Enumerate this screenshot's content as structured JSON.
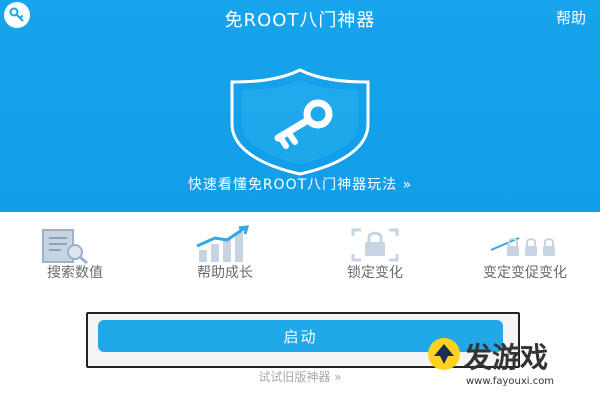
{
  "header": {
    "title": "免ROOT八门神器",
    "help_label": "帮助",
    "app_icon": "key-logo-icon"
  },
  "hero": {
    "shield_icon": "shield-key-icon",
    "tagline": "快速看懂免ROOT八门神器玩法 »"
  },
  "features": [
    {
      "label": "搜索数值",
      "icon": "search-document-icon"
    },
    {
      "label": "帮助成长",
      "icon": "growth-chart-icon"
    },
    {
      "label": "锁定变化",
      "icon": "lock-frame-icon"
    },
    {
      "label": "变定变促变化",
      "icon": "locks-chain-icon"
    }
  ],
  "actions": {
    "start_label": "启动",
    "old_version_label": "试试旧版神器 »"
  },
  "watermark": {
    "text": "发游戏",
    "url": "www.fayouxi.com"
  },
  "colors": {
    "header_blue": "#16a4ec",
    "button_blue": "#20a8e9"
  }
}
